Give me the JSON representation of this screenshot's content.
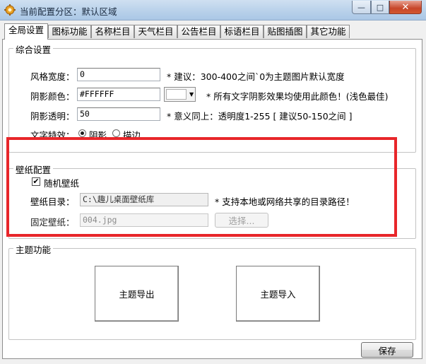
{
  "window": {
    "title": "当前配置分区：默认区域",
    "min_glyph": "—",
    "max_glyph": "□",
    "close_glyph": "✕"
  },
  "tabs": [
    {
      "label": "全局设置",
      "active": true
    },
    {
      "label": "图标功能"
    },
    {
      "label": "名称栏目"
    },
    {
      "label": "天气栏目"
    },
    {
      "label": "公告栏目"
    },
    {
      "label": "标语栏目"
    },
    {
      "label": "贴图插图"
    },
    {
      "label": "其它功能"
    }
  ],
  "general": {
    "title": "综合设置",
    "style_width": {
      "label": "风格宽度：",
      "value": "0",
      "hint": "* 建议：300-400之间`0为主题图片默认宽度"
    },
    "shadow_color": {
      "label": "阴影颜色：",
      "value": "#FFFFFF",
      "hint": "* 所有文字阴影效果均使用此颜色！(浅色最佳)"
    },
    "shadow_alpha": {
      "label": "阴影透明：",
      "value": "50",
      "hint": "* 意义同上：透明度1-255 [ 建议50-150之间 ]"
    },
    "text_effect": {
      "label": "文字特效：",
      "options": [
        "阴影",
        "描边"
      ],
      "selected": "阴影"
    }
  },
  "wallpaper": {
    "title": "壁纸配置",
    "random": {
      "label": "随机壁纸",
      "checked": true,
      "glyph": "✔"
    },
    "directory": {
      "label": "壁纸目录：",
      "value": "C:\\趣儿桌面壁纸库",
      "hint": "* 支持本地或网络共享的目录路径！"
    },
    "fixed": {
      "label": "固定壁纸：",
      "value": "004.jpg",
      "button": "选择..."
    }
  },
  "theme": {
    "title": "主题功能",
    "export_label": "主题导出",
    "import_label": "主题导入"
  },
  "footer": {
    "save_label": "保存"
  },
  "colors": {
    "highlight": "#e8262a",
    "titlebar": "#b9d1ea",
    "close_button": "#c7462a"
  }
}
